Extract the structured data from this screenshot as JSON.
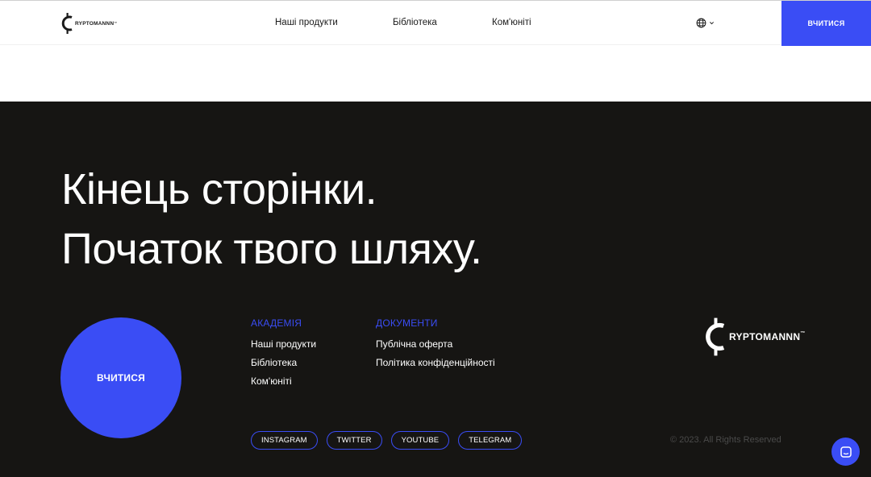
{
  "header": {
    "logo_text": "RYPTOMANNN",
    "logo_tm": "™",
    "nav": [
      {
        "label": "Наші продукти"
      },
      {
        "label": "Бібліотека"
      },
      {
        "label": "Ком'юніті"
      }
    ],
    "lang_icon": "globe-icon",
    "cta_label": "ВЧИТИСЯ"
  },
  "footer": {
    "headline_line1": "Кінець сторінки.",
    "headline_line2": "Початок твого шляху.",
    "circle_cta_label": "ВЧИТИСЯ",
    "academy": {
      "title": "АКАДЕМІЯ",
      "links": [
        "Наші продукти",
        "Бібліотека",
        "Ком'юніті"
      ]
    },
    "documents": {
      "title": "ДОКУМЕНТИ",
      "links": [
        "Публічна оферта",
        "Політика конфіденційності"
      ]
    },
    "logo_text": "RYPTOMANNN",
    "logo_tm": "™",
    "socials": [
      "INSTAGRAM",
      "TWITTER",
      "YOUTUBE",
      "TELEGRAM"
    ],
    "copyright": "© 2023. All Rights Reserved"
  },
  "chat_icon": "chat-icon",
  "colors": {
    "accent": "#3a4df5",
    "dark_bg": "#161513",
    "white": "#ffffff"
  }
}
